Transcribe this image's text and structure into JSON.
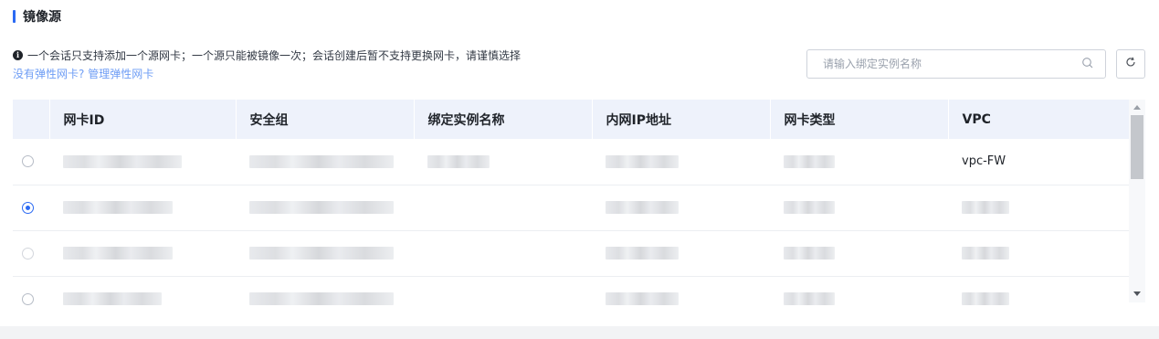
{
  "section": {
    "title": "镜像源"
  },
  "notice": {
    "text": "一个会话只支持添加一个源网卡；一个源只能被镜像一次；会话创建后暂不支持更换网卡，请谨慎选择",
    "link1": "没有弹性网卡?",
    "link2": "管理弹性网卡"
  },
  "search": {
    "placeholder": "请输入绑定实例名称",
    "value": ""
  },
  "icons": {
    "search": "search-icon",
    "refresh": "refresh-icon",
    "info": "info-icon"
  },
  "colors": {
    "accent": "#2b6af3",
    "link": "#6e9df5",
    "header_bg": "#eef2fb"
  },
  "table": {
    "columns": [
      "网卡ID",
      "安全组",
      "绑定实例名称",
      "内网IP地址",
      "网卡类型",
      "VPC"
    ],
    "rows": [
      {
        "checked": false,
        "vpc": "vpc-FW"
      },
      {
        "checked": true,
        "vpc": ""
      },
      {
        "checked": false,
        "vpc": ""
      },
      {
        "checked": false,
        "vpc": ""
      }
    ]
  }
}
